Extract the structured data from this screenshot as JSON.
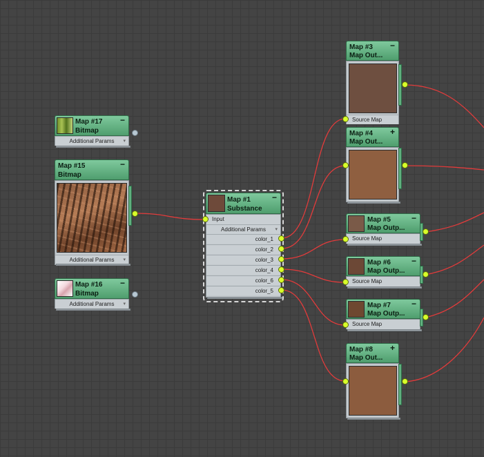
{
  "colors": {
    "header_green": "#5fae7d",
    "socket_active": "#d8ff2a",
    "socket_inactive": "#b7c7d2",
    "wire_red": "#e23b3b",
    "grid_bg": "#444444"
  },
  "nodes": {
    "map17": {
      "title": "Map #17",
      "subtitle": "Bitmap",
      "row": "Additional Params",
      "toggle": "−",
      "thumbnail": "grass-texture"
    },
    "map15": {
      "title": "Map #15",
      "subtitle": "Bitmap",
      "row": "Additional Params",
      "toggle": "−",
      "thumbnail": "rock-texture"
    },
    "map16": {
      "title": "Map #16",
      "subtitle": "Bitmap",
      "row": "Additional Params",
      "toggle": "−",
      "thumbnail": "pink-texture"
    },
    "map1": {
      "title": "Map #1",
      "subtitle": "Substance",
      "toggle": "−",
      "input_label": "Input",
      "params_label": "Additional Params",
      "swatch": "#6e4a3a",
      "outputs": [
        "color_1",
        "color_2",
        "color_3",
        "color_4",
        "color_6",
        "color_5"
      ]
    },
    "map3": {
      "title": "Map #3",
      "subtitle": "Map Out...",
      "toggle": "−",
      "swatch": "#6e4f40",
      "row": "Source Map"
    },
    "map4": {
      "title": "Map #4",
      "subtitle": "Map Out...",
      "toggle": "+",
      "swatch": "#8f5f40"
    },
    "map5": {
      "title": "Map #5",
      "subtitle": "Map Outp...",
      "toggle": "−",
      "swatch": "#7a5a48",
      "row": "Source Map"
    },
    "map6": {
      "title": "Map #6",
      "subtitle": "Map Outp...",
      "toggle": "−",
      "swatch": "#6c4836",
      "row": "Source Map"
    },
    "map7": {
      "title": "Map #7",
      "subtitle": "Map Outp...",
      "toggle": "−",
      "swatch": "#6e4830",
      "row": "Source Map"
    },
    "map8": {
      "title": "Map #8",
      "subtitle": "Map Out...",
      "toggle": "+",
      "swatch": "#8c5c3e"
    }
  }
}
